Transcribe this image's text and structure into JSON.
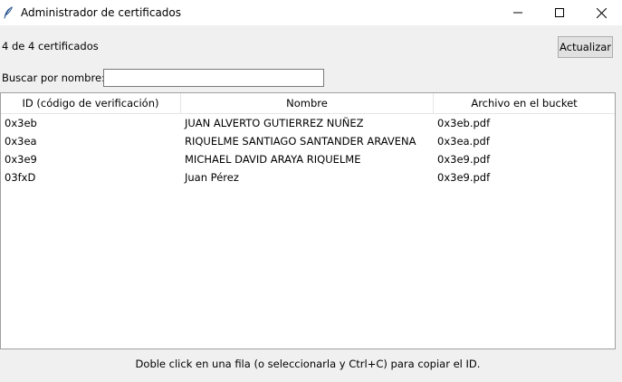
{
  "window": {
    "title": "Administrador de certificados",
    "icons": {
      "app": "feather-icon",
      "minimize": "minimize-icon",
      "maximize": "maximize-icon",
      "close": "close-icon"
    }
  },
  "toolbar": {
    "count_label": "4 de 4 certificados",
    "refresh_label": "Actualizar"
  },
  "search": {
    "label": "Buscar por nombre:",
    "value": "",
    "placeholder": ""
  },
  "table": {
    "columns": [
      "ID (código de verificación)",
      "Nombre",
      "Archivo en el bucket"
    ],
    "rows": [
      {
        "id": "0x3eb",
        "name": "JUAN ALVERTO GUTIERREZ NUÑEZ",
        "file": "0x3eb.pdf"
      },
      {
        "id": "0x3ea",
        "name": "RIQUELME SANTIAGO SANTANDER ARAVENA",
        "file": "0x3ea.pdf"
      },
      {
        "id": "0x3e9",
        "name": "MICHAEL DAVID ARAYA RIQUELME",
        "file": "0x3e9.pdf"
      },
      {
        "id": "03fxD",
        "name": "Juan Pérez",
        "file": "0x3e9.pdf"
      }
    ]
  },
  "footer": {
    "hint": "Doble click en una fila (o seleccionarla y Ctrl+C) para copiar el ID."
  }
}
